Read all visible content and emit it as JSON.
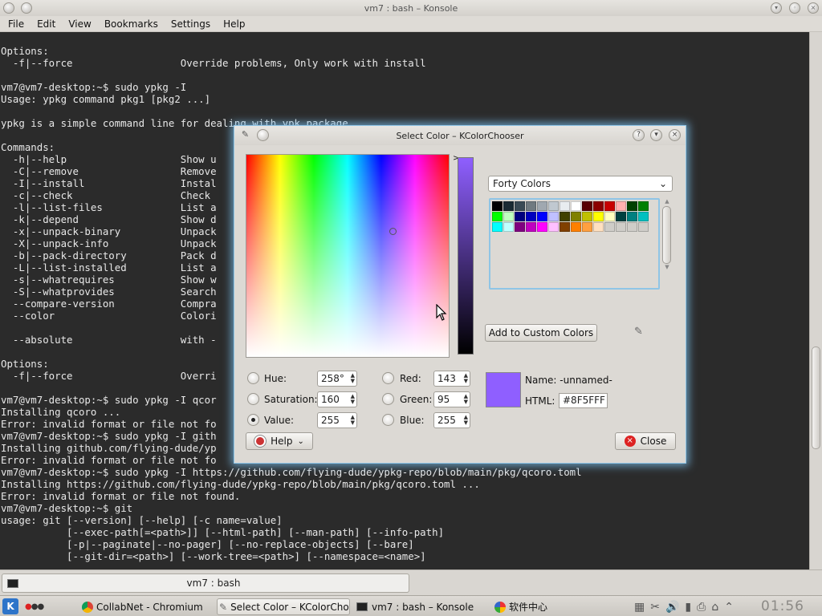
{
  "konsole": {
    "title": "vm7 : bash – Konsole",
    "menu": [
      "File",
      "Edit",
      "View",
      "Bookmarks",
      "Settings",
      "Help"
    ],
    "terminal_lines": [
      "Options:",
      "  -f|--force                  Override problems, Only work with install",
      "",
      "vm7@vm7-desktop:~$ sudo ypkg -I",
      "Usage: ypkg command pkg1 [pkg2 ...]",
      "",
      "ypkg is a simple command line for dealing with ypk package.",
      "",
      "Commands:",
      "  -h|--help                   Show u",
      "  -C|--remove                 Remove",
      "  -I|--install                Instal",
      "  -c|--check                  Check ",
      "  -l|--list-files             List a",
      "  -k|--depend                 Show d",
      "  -x|--unpack-binary          Unpack",
      "  -X|--unpack-info            Unpack",
      "  -b|--pack-directory         Pack d",
      "  -L|--list-installed         List a",
      "  -s|--whatrequires           Show w",
      "  -S|--whatprovides           Search",
      "  --compare-version           Compra",
      "  --color                     Colori",
      "",
      "  --absolute                  with -",
      "",
      "Options:",
      "  -f|--force                  Overri",
      "",
      "vm7@vm7-desktop:~$ sudo ypkg -I qcor",
      "Installing qcoro ...",
      "Error: invalid format or file not fo",
      "vm7@vm7-desktop:~$ sudo ypkg -I gith",
      "Installing github.com/flying-dude/yp",
      "Error: invalid format or file not fo",
      "vm7@vm7-desktop:~$ sudo ypkg -I https://github.com/flying-dude/ypkg-repo/blob/main/pkg/qcoro.toml",
      "Installing https://github.com/flying-dude/ypkg-repo/blob/main/pkg/qcoro.toml ...",
      "Error: invalid format or file not found.",
      "vm7@vm7-desktop:~$ git",
      "usage: git [--version] [--help] [-c name=value]",
      "           [--exec-path[=<path>]] [--html-path] [--man-path] [--info-path]",
      "           [-p|--paginate|--no-pager] [--no-replace-objects] [--bare]",
      "           [--git-dir=<path>] [--work-tree=<path>] [--namespace=<name>]"
    ],
    "tab_label": "vm7 : bash"
  },
  "dialog": {
    "title": "Select Color – KColorChooser",
    "fields": {
      "hue": {
        "label": "Hue:",
        "value": "258°"
      },
      "saturation": {
        "label": "Saturation:",
        "value": "160"
      },
      "value": {
        "label": "Value:",
        "value": "255"
      },
      "red": {
        "label": "Red:",
        "value": "143"
      },
      "green": {
        "label": "Green:",
        "value": "95"
      },
      "blue": {
        "label": "Blue:",
        "value": "255"
      }
    },
    "selected_mode": "value",
    "palette": "Forty Colors",
    "swatches": [
      "#000000",
      "#1a2a33",
      "#3a4a55",
      "#707a80",
      "#a0a8b0",
      "#c0c8d0",
      "#e8ecf0",
      "#ffffff",
      "#5a0000",
      "#8c0000",
      "#c80000",
      "#ffb0b0",
      "#004000",
      "#008000",
      "#00ff00",
      "#c0ffc0",
      "#000080",
      "#0000c0",
      "#0000ff",
      "#c0c0ff",
      "#404000",
      "#808000",
      "#c0c000",
      "#ffff00",
      "#ffffc0",
      "#004040",
      "#008080",
      "#00c0c0",
      "#00ffff",
      "#c0ffff",
      "#800080",
      "#c000c0",
      "#ff00ff",
      "#ffc0ff",
      "#804000",
      "#ff8000",
      "#ffa040",
      "#ffe0c0",
      "#cfcdc8",
      "#cfcdc8",
      "#cfcdc8",
      "#cfcdc8"
    ],
    "add_custom_label": "Add to Custom Colors",
    "name_label": "Name:",
    "name_value": "-unnamed-",
    "html_label": "HTML:",
    "html_value": "#8F5FFF",
    "current_color": "#8F5FFF",
    "help_label": "Help",
    "close_label": "Close"
  },
  "taskbar": {
    "tasks": [
      "CollabNet - Chromium",
      "Select Color – KColorCho",
      "vm7 : bash – Konsole",
      "软件中心"
    ],
    "clock": "01:56"
  },
  "colors": {
    "accent": "#8fc5e6",
    "terminal_bg": "#2b2b2b",
    "chrome_bg": "#dcd9d4"
  }
}
